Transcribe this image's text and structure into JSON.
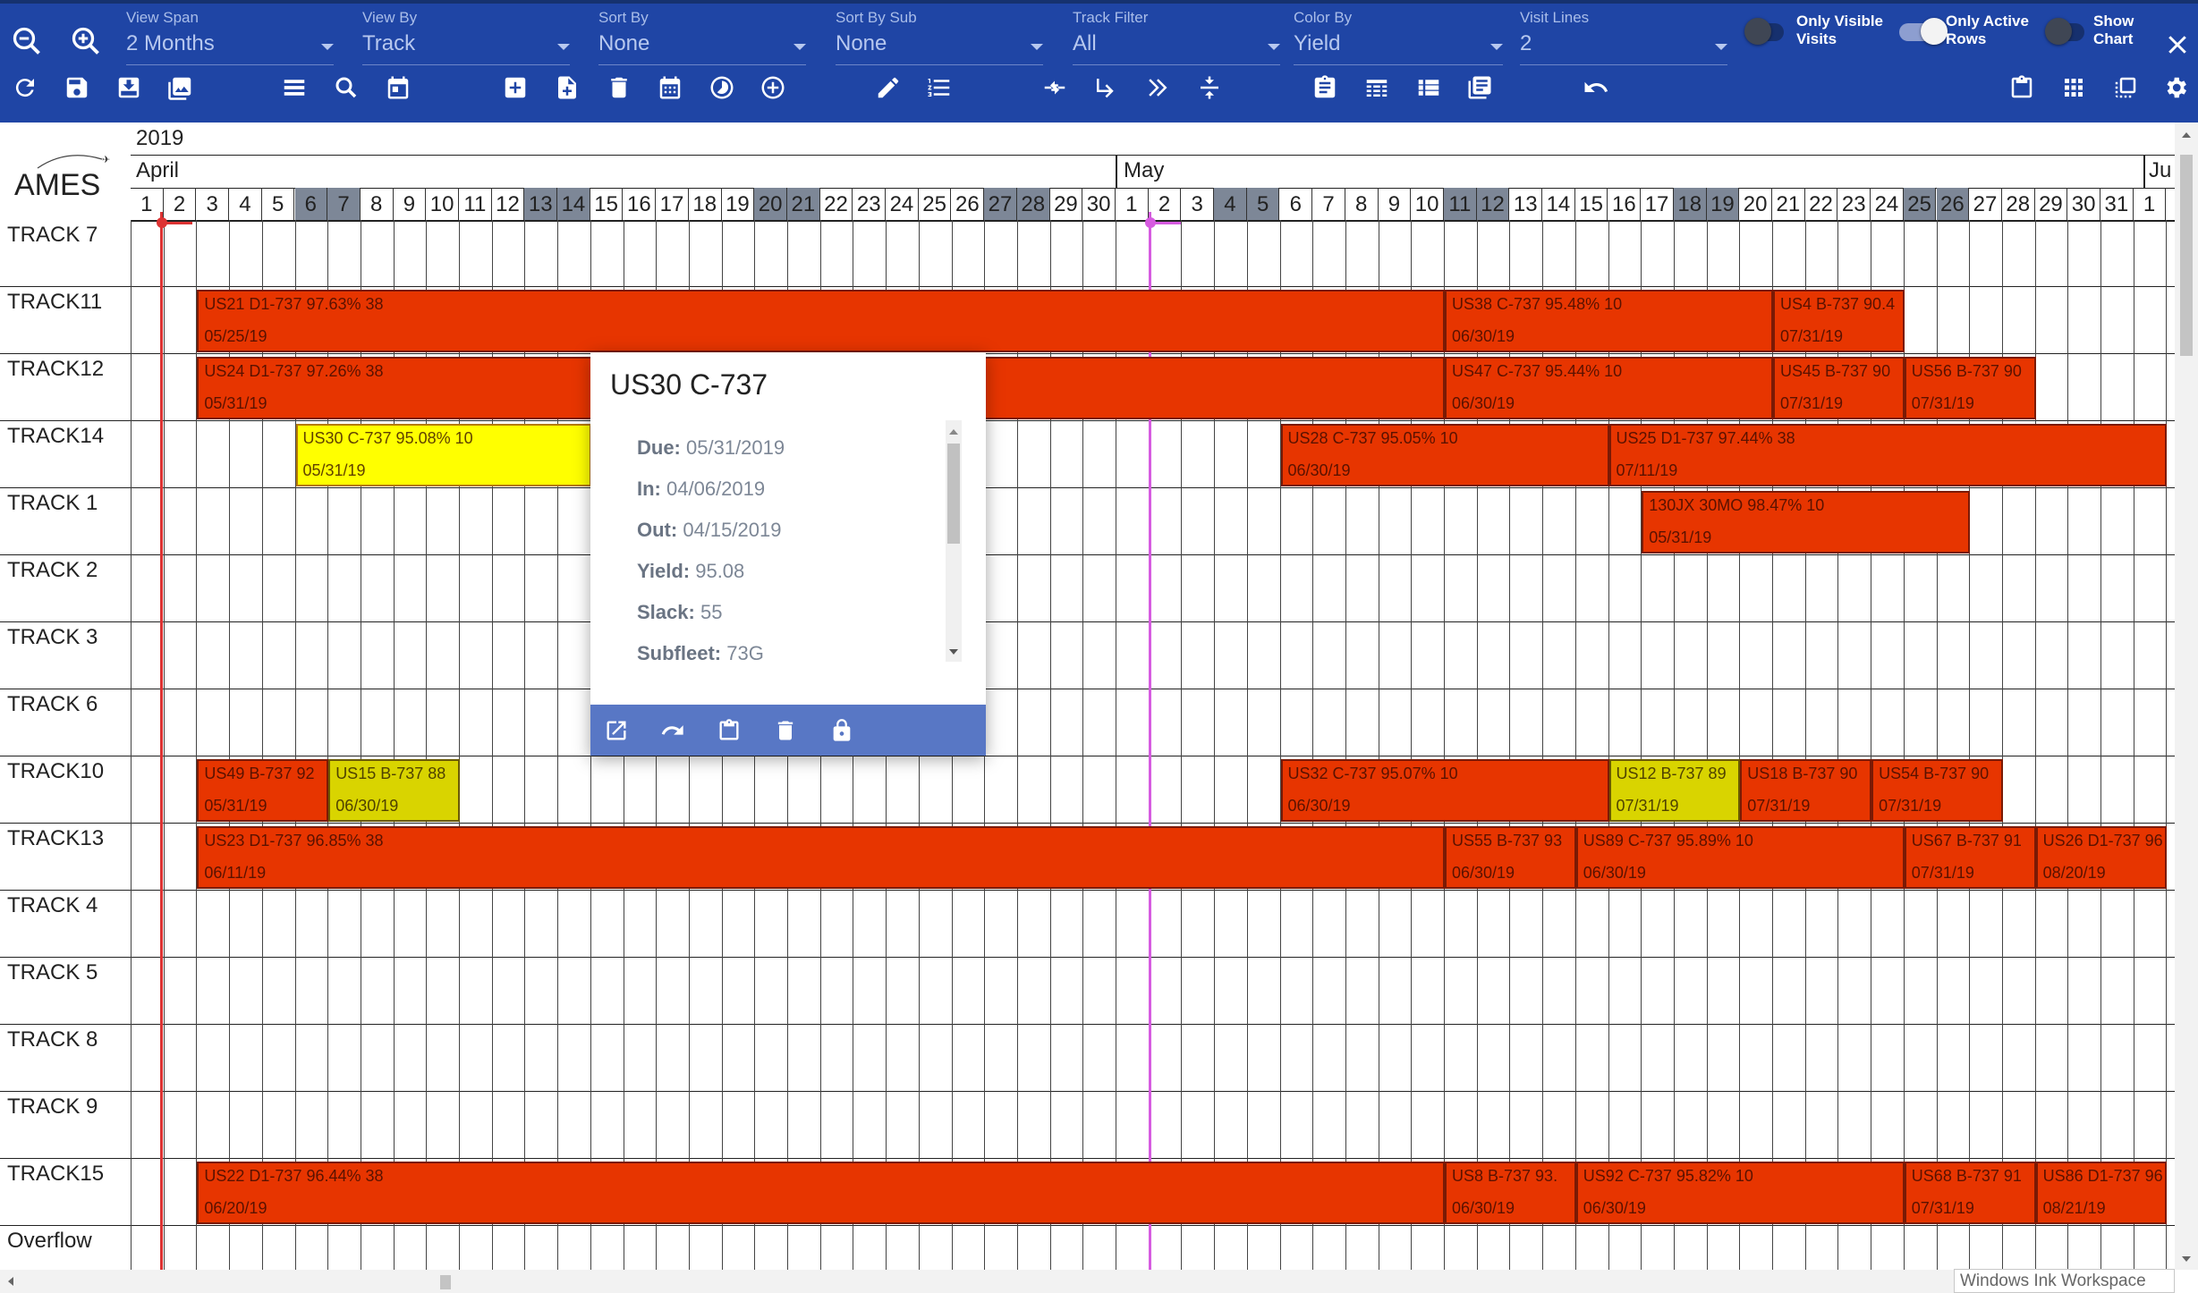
{
  "toolbar": {
    "controls": [
      {
        "label": "View Span",
        "value": "2 Months"
      },
      {
        "label": "View By",
        "value": "Track"
      },
      {
        "label": "Sort By",
        "value": "None"
      },
      {
        "label": "Sort By Sub",
        "value": "None"
      },
      {
        "label": "Track Filter",
        "value": "All"
      },
      {
        "label": "Color By",
        "value": "Yield"
      },
      {
        "label": "Visit Lines",
        "value": "2"
      }
    ],
    "toggles": [
      {
        "label": "Only Visible Visits",
        "on": false
      },
      {
        "label": "Only Active Rows",
        "on": true
      },
      {
        "label": "Show Chart",
        "on": false
      }
    ]
  },
  "logo_text": "AMES",
  "timeline": {
    "year": "2019",
    "months": [
      "April",
      "May",
      "Ju"
    ],
    "april_days": [
      "1",
      "2",
      "3",
      "4",
      "5",
      "6",
      "7",
      "8",
      "9",
      "10",
      "11",
      "12",
      "13",
      "14",
      "15",
      "16",
      "17",
      "18",
      "19",
      "20",
      "21",
      "22",
      "23",
      "24",
      "25",
      "26",
      "27",
      "28",
      "29",
      "30"
    ],
    "may_days": [
      "1",
      "2",
      "3",
      "4",
      "5",
      "6",
      "7",
      "8",
      "9",
      "10",
      "11",
      "12",
      "13",
      "14",
      "15",
      "16",
      "17",
      "18",
      "19",
      "20",
      "21",
      "22",
      "23",
      "24",
      "25",
      "26",
      "27",
      "28",
      "29",
      "30",
      "31"
    ],
    "june_days": [
      "1"
    ]
  },
  "tracks": [
    "TRACK 7",
    "TRACK11",
    "TRACK12",
    "TRACK14",
    "TRACK 1",
    "TRACK 2",
    "TRACK 3",
    "TRACK 6",
    "TRACK10",
    "TRACK13",
    "TRACK 4",
    "TRACK 5",
    "TRACK 8",
    "TRACK 9",
    "TRACK15",
    "Overflow"
  ],
  "visits": [
    {
      "row": 1,
      "l1": "US21 D1-737 97.63% 38",
      "l2": "05/25/19",
      "color": "red"
    },
    {
      "row": 1,
      "l1": "US38 C-737 95.48% 10",
      "l2": "06/30/19",
      "color": "red"
    },
    {
      "row": 1,
      "l1": "US4 B-737 90.4",
      "l2": "07/31/19",
      "color": "red"
    },
    {
      "row": 2,
      "l1": "US24 D1-737 97.26% 38",
      "l2": "05/31/19",
      "color": "red"
    },
    {
      "row": 2,
      "l1": "US47 C-737 95.44% 10",
      "l2": "06/30/19",
      "color": "red"
    },
    {
      "row": 2,
      "l1": "US45 B-737 90",
      "l2": "07/31/19",
      "color": "red"
    },
    {
      "row": 2,
      "l1": "US56 B-737 90",
      "l2": "07/31/19",
      "color": "red"
    },
    {
      "row": 3,
      "l1": "US30 C-737 95.08% 10",
      "l2": "05/31/19",
      "color": "yellow"
    },
    {
      "row": 3,
      "l1": "US28 C-737 95.05% 10",
      "l2": "06/30/19",
      "color": "red"
    },
    {
      "row": 3,
      "l1": "US25 D1-737 97.44% 38",
      "l2": "07/11/19",
      "color": "red"
    },
    {
      "row": 4,
      "l1": "130JX 30MO 98.47% 10",
      "l2": "05/31/19",
      "color": "red"
    },
    {
      "row": 8,
      "l1": "US49 B-737 92",
      "l2": "05/31/19",
      "color": "red"
    },
    {
      "row": 8,
      "l1": "US15 B-737 88",
      "l2": "06/30/19",
      "color": "darkyellow"
    },
    {
      "row": 8,
      "l1": "US32 C-737 95.07% 10",
      "l2": "06/30/19",
      "color": "red"
    },
    {
      "row": 8,
      "l1": "US12 B-737 89",
      "l2": "07/31/19",
      "color": "darkyellow"
    },
    {
      "row": 8,
      "l1": "US18 B-737 90",
      "l2": "07/31/19",
      "color": "red"
    },
    {
      "row": 8,
      "l1": "US54 B-737 90",
      "l2": "07/31/19",
      "color": "red"
    },
    {
      "row": 9,
      "l1": "US23 D1-737 96.85% 38",
      "l2": "06/11/19",
      "color": "red"
    },
    {
      "row": 9,
      "l1": "US55 B-737 93",
      "l2": "06/30/19",
      "color": "red"
    },
    {
      "row": 9,
      "l1": "US89 C-737 95.89% 10",
      "l2": "06/30/19",
      "color": "red"
    },
    {
      "row": 9,
      "l1": "US67 B-737 91",
      "l2": "07/31/19",
      "color": "red"
    },
    {
      "row": 9,
      "l1": "US26 D1-737 96",
      "l2": "08/20/19",
      "color": "red"
    },
    {
      "row": 14,
      "l1": "US22 D1-737 96.44% 38",
      "l2": "06/20/19",
      "color": "red"
    },
    {
      "row": 14,
      "l1": "US8 B-737 93.",
      "l2": "06/30/19",
      "color": "red"
    },
    {
      "row": 14,
      "l1": "US92 C-737 95.82% 10",
      "l2": "06/30/19",
      "color": "red"
    },
    {
      "row": 14,
      "l1": "US68 B-737 91",
      "l2": "07/31/19",
      "color": "red"
    },
    {
      "row": 14,
      "l1": "US86 D1-737 96",
      "l2": "08/21/19",
      "color": "red"
    }
  ],
  "popup": {
    "title": "US30 C-737",
    "fields": [
      {
        "label": "Due:",
        "value": "05/31/2019"
      },
      {
        "label": "In:",
        "value": "04/06/2019"
      },
      {
        "label": "Out:",
        "value": "04/15/2019"
      },
      {
        "label": "Yield:",
        "value": "95.08"
      },
      {
        "label": "Slack:",
        "value": "55"
      },
      {
        "label": "Subfleet:",
        "value": "73G"
      }
    ]
  },
  "taskbar_hint": "Windows Ink Workspace",
  "colors": {
    "toolbar": "#1f45a5",
    "visit_red": "#e73500",
    "visit_yellow": "#ffff00",
    "weekend": "#7d8797",
    "today": "#dd3333",
    "marker": "#d65be0"
  }
}
